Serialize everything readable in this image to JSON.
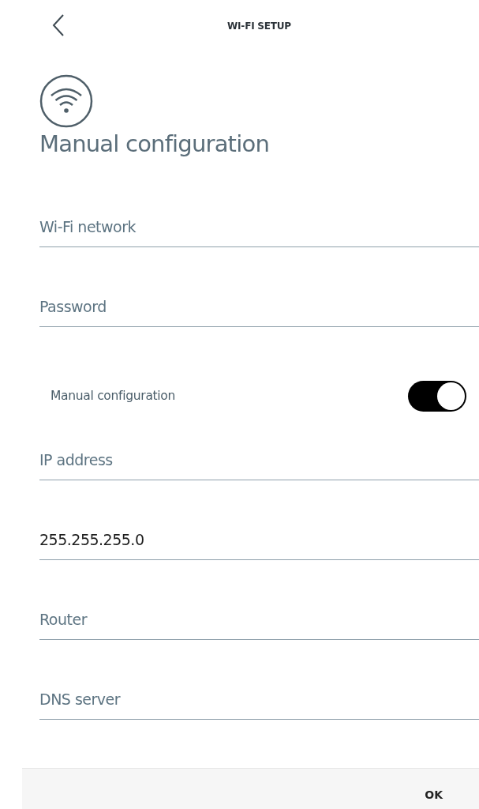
{
  "header": {
    "title": "WI-FI SETUP"
  },
  "heading": "Manual configuration",
  "fields_top": [
    {
      "kind": "placeholder",
      "placeholder": "Wi-Fi network"
    },
    {
      "kind": "placeholder",
      "placeholder": "Password"
    }
  ],
  "toggle": {
    "label": "Manual configuration",
    "on": true
  },
  "fields_bottom": [
    {
      "kind": "placeholder",
      "placeholder": "IP address"
    },
    {
      "kind": "value",
      "value": "255.255.255.0"
    },
    {
      "kind": "placeholder",
      "placeholder": "Router"
    },
    {
      "kind": "placeholder",
      "placeholder": "DNS server"
    }
  ],
  "footer": {
    "button": "OK"
  }
}
